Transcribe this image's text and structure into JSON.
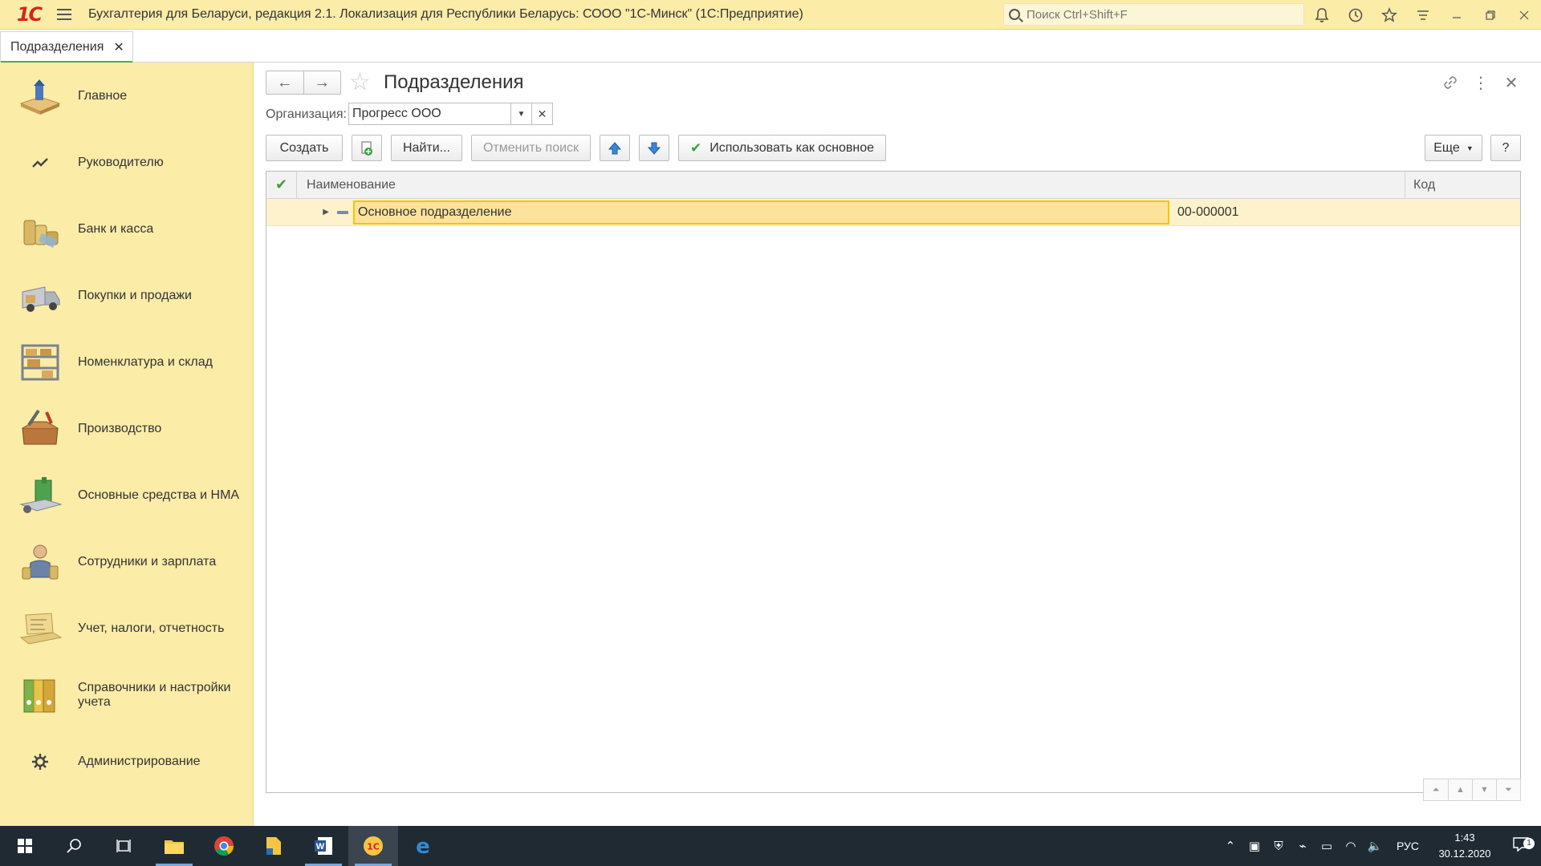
{
  "app": {
    "logo": "1С",
    "title": "Бухгалтерия для Беларуси, редакция 2.1. Локализация для Республики Беларусь: СООО \"1С-Минск\"  (1С:Предприятие)",
    "search_placeholder": "Поиск Ctrl+Shift+F",
    "titlebar_icons": [
      "bell-icon",
      "history-icon",
      "star-icon",
      "menu-icon",
      "minimize-icon",
      "restore-icon",
      "close-icon"
    ]
  },
  "tabs": [
    {
      "label": "Подразделения",
      "close": "✕"
    }
  ],
  "sidebar": {
    "items": [
      {
        "label": "Главное",
        "icon": "home-icon"
      },
      {
        "label": "Руководителю",
        "icon": "chart-trend-icon"
      },
      {
        "label": "Банк и касса",
        "icon": "coins-icon"
      },
      {
        "label": "Покупки и продажи",
        "icon": "truck-icon"
      },
      {
        "label": "Номенклатура и склад",
        "icon": "warehouse-icon"
      },
      {
        "label": "Производство",
        "icon": "toolbox-icon"
      },
      {
        "label": "Основные средства и НМА",
        "icon": "building-icon"
      },
      {
        "label": "Сотрудники и зарплата",
        "icon": "employee-icon"
      },
      {
        "label": "Учет, налоги, отчетность",
        "icon": "laptop-icon"
      },
      {
        "label": "Справочники и настройки учета",
        "icon": "binders-icon"
      },
      {
        "label": "Администрирование",
        "icon": "gear-icon"
      }
    ]
  },
  "form": {
    "title": "Подразделения",
    "org_label": "Организация:",
    "org_value": "Прогресс ООО",
    "toolbar": {
      "create": "Создать",
      "find": "Найти...",
      "cancel_search": "Отменить поиск",
      "use_as_main": "Использовать как основное",
      "more": "Еще",
      "help": "?"
    },
    "table": {
      "columns": [
        "Наименование",
        "Код"
      ],
      "rows": [
        {
          "name": "Основное подразделение",
          "code": "00-000001"
        }
      ]
    }
  },
  "taskbar": {
    "lang": "РУС",
    "time": "1:43",
    "date": "30.12.2020",
    "notifications": "1"
  }
}
